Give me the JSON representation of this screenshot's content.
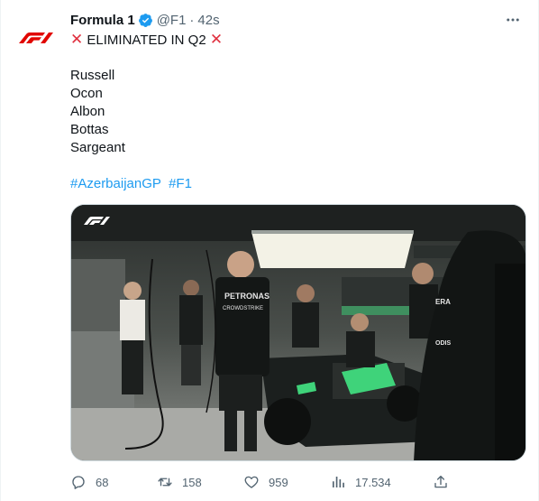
{
  "author": {
    "name": "Formula 1",
    "handle": "@F1",
    "separator": "·",
    "time": "42s",
    "avatar_icon": "f1-logo-icon",
    "verified_icon": "verified-badge-icon"
  },
  "tweet": {
    "headline": "ELIMINATED IN Q2",
    "headline_icon": "red-x-icon",
    "drivers": [
      "Russell",
      "Ocon",
      "Albon",
      "Bottas",
      "Sargeant"
    ],
    "hashtags": [
      "#AzerbaijanGP",
      "#F1"
    ]
  },
  "media": {
    "shirt_text_1": "PETRONAS",
    "shirt_text_2": "CROWDSTRIKE",
    "shirt_text_3": "ERA",
    "shirt_text_4": "ODIS"
  },
  "actions": {
    "replies": "68",
    "retweets": "158",
    "likes": "959",
    "views": "17.534"
  },
  "colors": {
    "accent": "#1d9bf0",
    "secondary_text": "#536471",
    "brand_red": "#e10600",
    "x_red": "#e0303f"
  }
}
